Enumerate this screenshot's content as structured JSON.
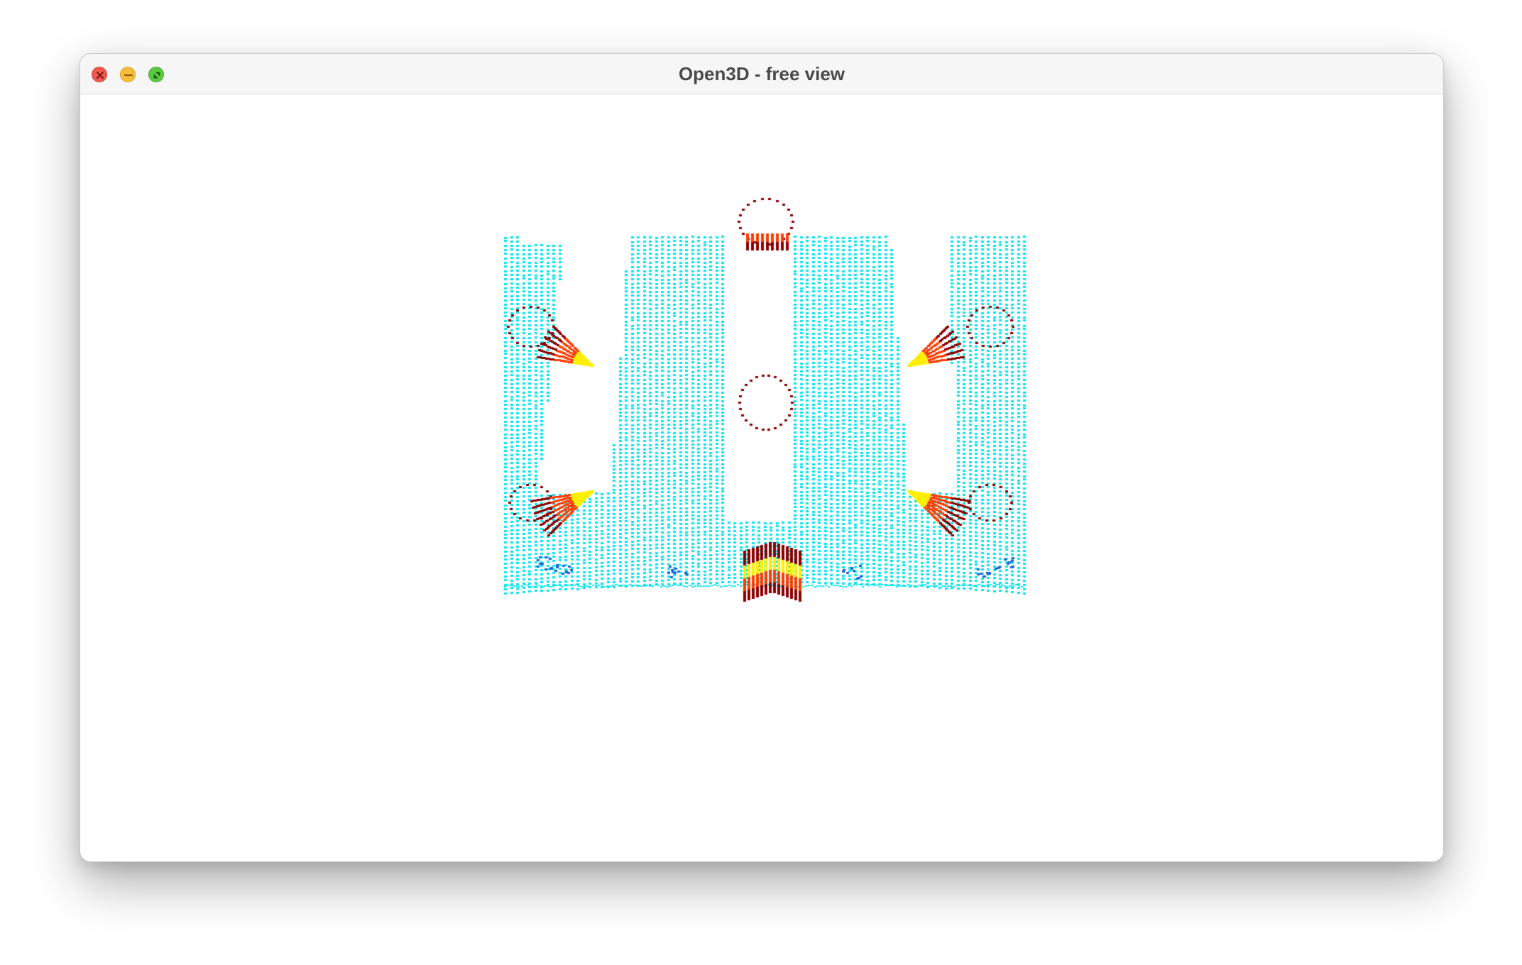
{
  "window": {
    "title": "Open3D - free view"
  },
  "controls": {
    "close": "close-icon",
    "minimize": "minimize-icon",
    "maximize": "fullscreen-icon"
  },
  "colors": {
    "ground": "#00e5f0",
    "obstacle_far": "#8b0000",
    "obstacle_mid": "#ff3c00",
    "obstacle_near": "#ffee00",
    "low_points": "#1f5fd6"
  }
}
